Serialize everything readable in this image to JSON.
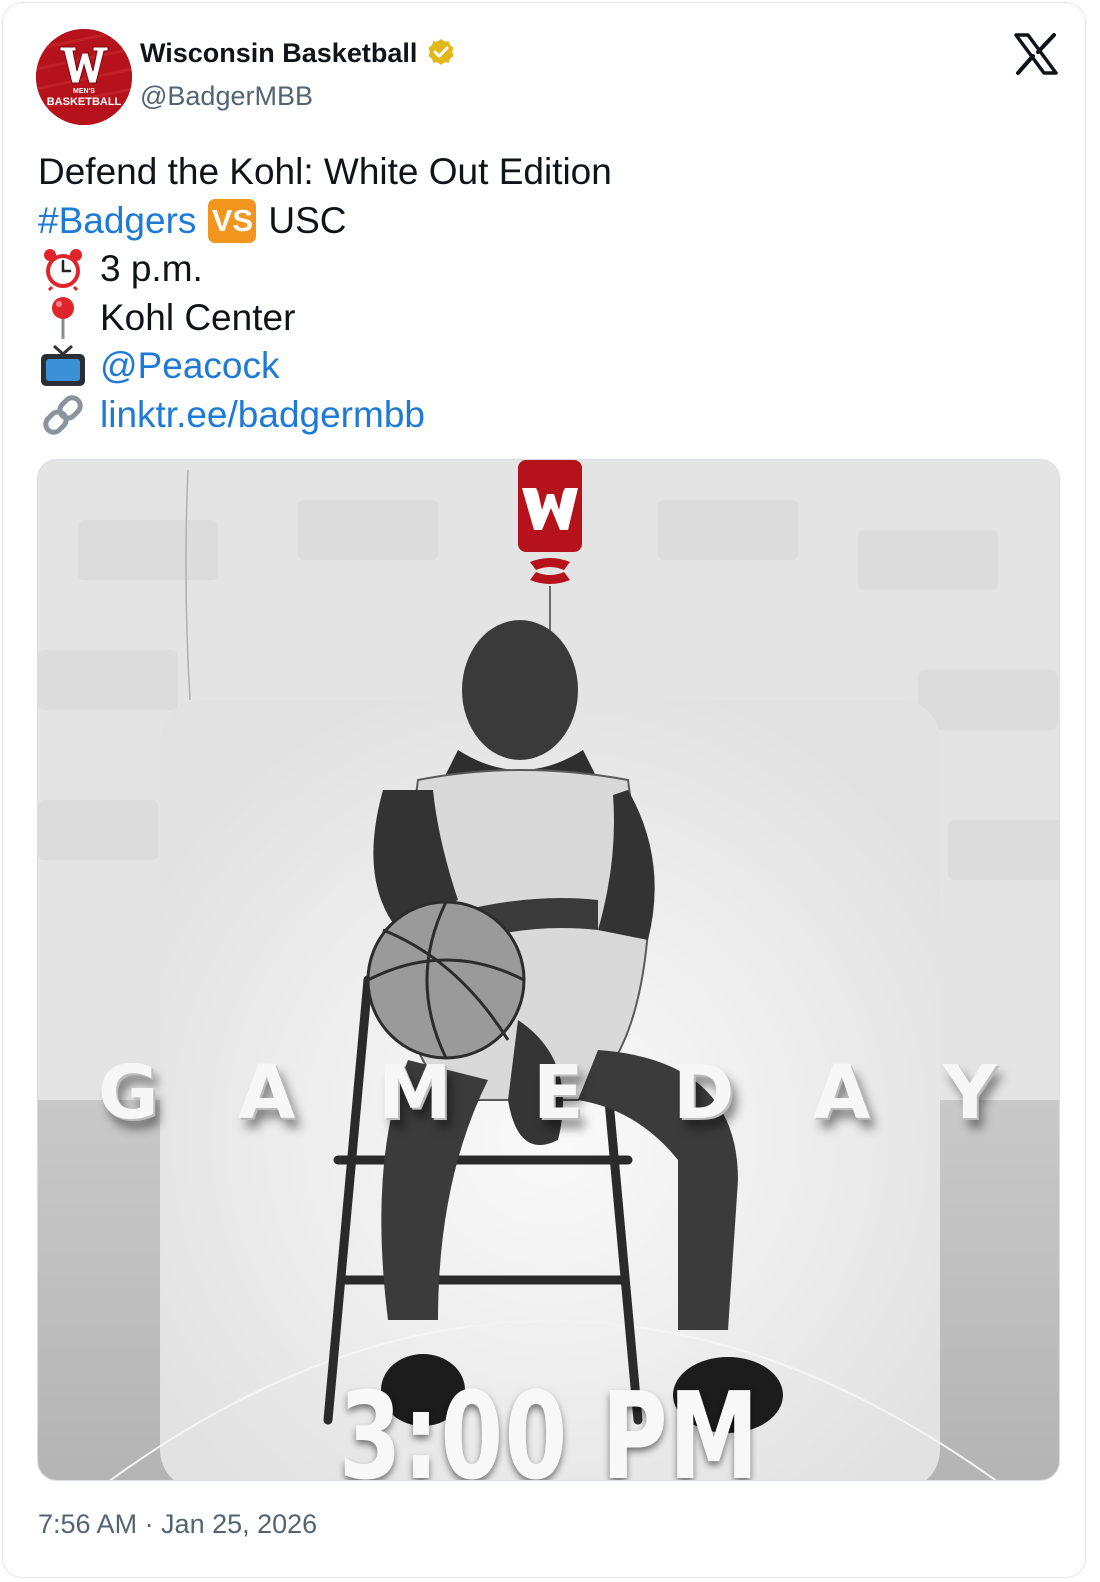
{
  "author": {
    "display_name": "Wisconsin Basketball",
    "handle": "@BadgerMBB",
    "avatar_text_top": "MEN'S",
    "avatar_text_bottom": "BASKETBALL"
  },
  "tweet": {
    "line1": "Defend the Kohl: White Out Edition",
    "hashtag": "#Badgers",
    "vs_label": "VS",
    "opponent": "USC",
    "time": "3 p.m.",
    "venue": "Kohl Center",
    "broadcast": "@Peacock",
    "link": "linktr.ee/badgermbb"
  },
  "media": {
    "headline_letters": [
      "G",
      "A",
      "M",
      "E",
      "D",
      "A",
      "Y"
    ],
    "game_time": "3:00 PM"
  },
  "timestamp": "7:56 AM · Jan 25, 2026",
  "icons": {
    "verified": "verified-badge-icon",
    "platform": "x-logo-icon",
    "time": "alarm-clock-icon",
    "venue": "pushpin-icon",
    "broadcast": "television-icon",
    "link": "link-icon"
  },
  "colors": {
    "brand_red": "#b5121b",
    "link_blue": "#1d7ad6",
    "vs_orange": "#f1951f",
    "verified_gold": "#e2b719"
  }
}
